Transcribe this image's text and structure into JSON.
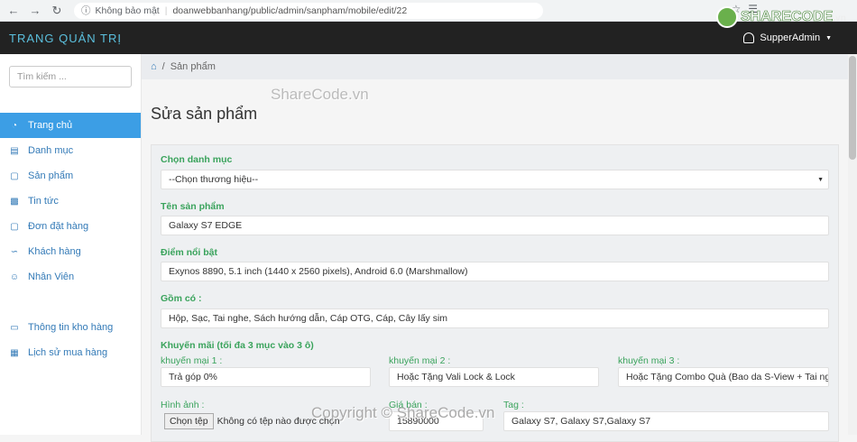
{
  "browser": {
    "security_label": "Không bảo mật",
    "url": "doanwebbanhang/public/admin/sanpham/mobile/edit/22"
  },
  "watermark": {
    "logo_text": "SHARECODE",
    "logo_domain": ".vn",
    "center_text": "ShareCode.vn",
    "bottom_text": "Copyright © ShareCode.vn"
  },
  "header": {
    "brand": "TRANG QUẢN TRỊ",
    "user": "SupperAdmin"
  },
  "sidebar": {
    "search_placeholder": "Tìm kiếm ...",
    "items": [
      {
        "label": "Trang chủ",
        "icon": "dashboard-icon"
      },
      {
        "label": "Danh mục",
        "icon": "list-icon"
      },
      {
        "label": "Sản phẩm",
        "icon": "bag-icon"
      },
      {
        "label": "Tin tức",
        "icon": "document-icon"
      },
      {
        "label": "Đơn đặt hàng",
        "icon": "basket-icon"
      },
      {
        "label": "Khách hàng",
        "icon": "chart-icon"
      },
      {
        "label": "Nhân Viên",
        "icon": "user-icon"
      },
      {
        "label": "Thông tin kho hàng",
        "icon": "monitor-icon"
      },
      {
        "label": "Lịch sử mua hàng",
        "icon": "table-icon"
      }
    ]
  },
  "breadcrumb": {
    "current": "Sản phẩm"
  },
  "page": {
    "title": "Sửa sản phẩm"
  },
  "form": {
    "category_label": "Chọn danh mục",
    "category_value": "--Chọn thương hiệu--",
    "name_label": "Tên sản phẩm",
    "name_value": "Galaxy S7 EDGE",
    "highlight_label": "Điểm nổi bật",
    "highlight_value": "Exynos 8890, 5.1 inch (1440 x 2560 pixels), Android 6.0 (Marshmallow)",
    "includes_label": "Gồm có :",
    "includes_value": "Hộp, Sạc, Tai nghe, Sách hướng dẫn, Cáp OTG, Cáp, Cây lấy sim",
    "promo_label": "Khuyến mãi (tối đa 3 mục vào 3 ô)",
    "promo1_label": "khuyến mại 1 :",
    "promo1_value": "Trả góp 0%",
    "promo2_label": "khuyến mại 2 :",
    "promo2_value": "Hoặc Tặng Vali Lock & Lock",
    "promo3_label": "khuyến mại 3 :",
    "promo3_value": "Hoặc Tặng Combo Quà (Bao da S-View + Tai ngh",
    "image_label": "Hình ảnh :",
    "file_button": "Chọn tệp",
    "file_status": "Không có tệp nào được chọn",
    "price_label": "Giá bán :",
    "price_value": "15890000",
    "tag_label": "Tag :",
    "tag_value": "Galaxy S7, Galaxy S7,Galaxy S7"
  }
}
